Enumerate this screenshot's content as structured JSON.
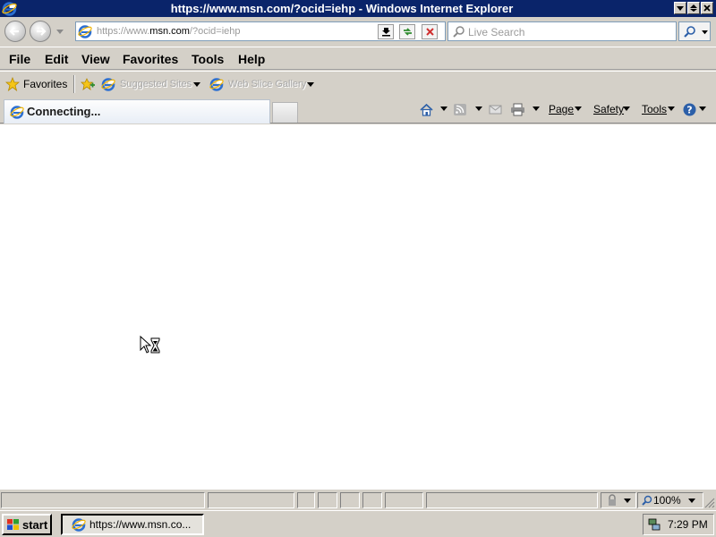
{
  "window": {
    "title": "https://www.msn.com/?ocid=iehp - Windows Internet Explorer"
  },
  "address_bar": {
    "url_prefix": "https://www.",
    "url_domain": "msn.com",
    "url_path": "/?ocid=iehp"
  },
  "search": {
    "placeholder": "Live Search"
  },
  "menu": {
    "file": "File",
    "edit": "Edit",
    "view": "View",
    "favorites": "Favorites",
    "tools": "Tools",
    "help": "Help"
  },
  "favorites_bar": {
    "favorites_label": "Favorites",
    "suggested_sites": "Suggested Sites",
    "web_slice_gallery": "Web Slice Gallery"
  },
  "tabs": {
    "active_label": "Connecting..."
  },
  "command_bar": {
    "page": "Page",
    "safety": "Safety",
    "tools": "Tools"
  },
  "status_bar": {
    "zoom": "100%"
  },
  "taskbar": {
    "start_label": "start",
    "task_label": "https://www.msn.co...",
    "clock": "7:29 PM"
  },
  "icons": {
    "browser": "ie-logo-icon",
    "back": "back-arrow-icon",
    "forward": "forward-arrow-icon",
    "refresh": "refresh-icon",
    "stop": "stop-icon",
    "search": "magnifier-icon",
    "home": "home-icon",
    "feeds": "rss-feed-icon",
    "mail": "mail-icon",
    "print": "printer-icon",
    "help": "help-icon",
    "cursor": "busy-cursor-icon"
  },
  "colors": {
    "title_bar": "#0a246a",
    "window_chrome": "#d4d0c8",
    "content_background": "#ffffff",
    "ie_blue": "#2c6fd1"
  }
}
